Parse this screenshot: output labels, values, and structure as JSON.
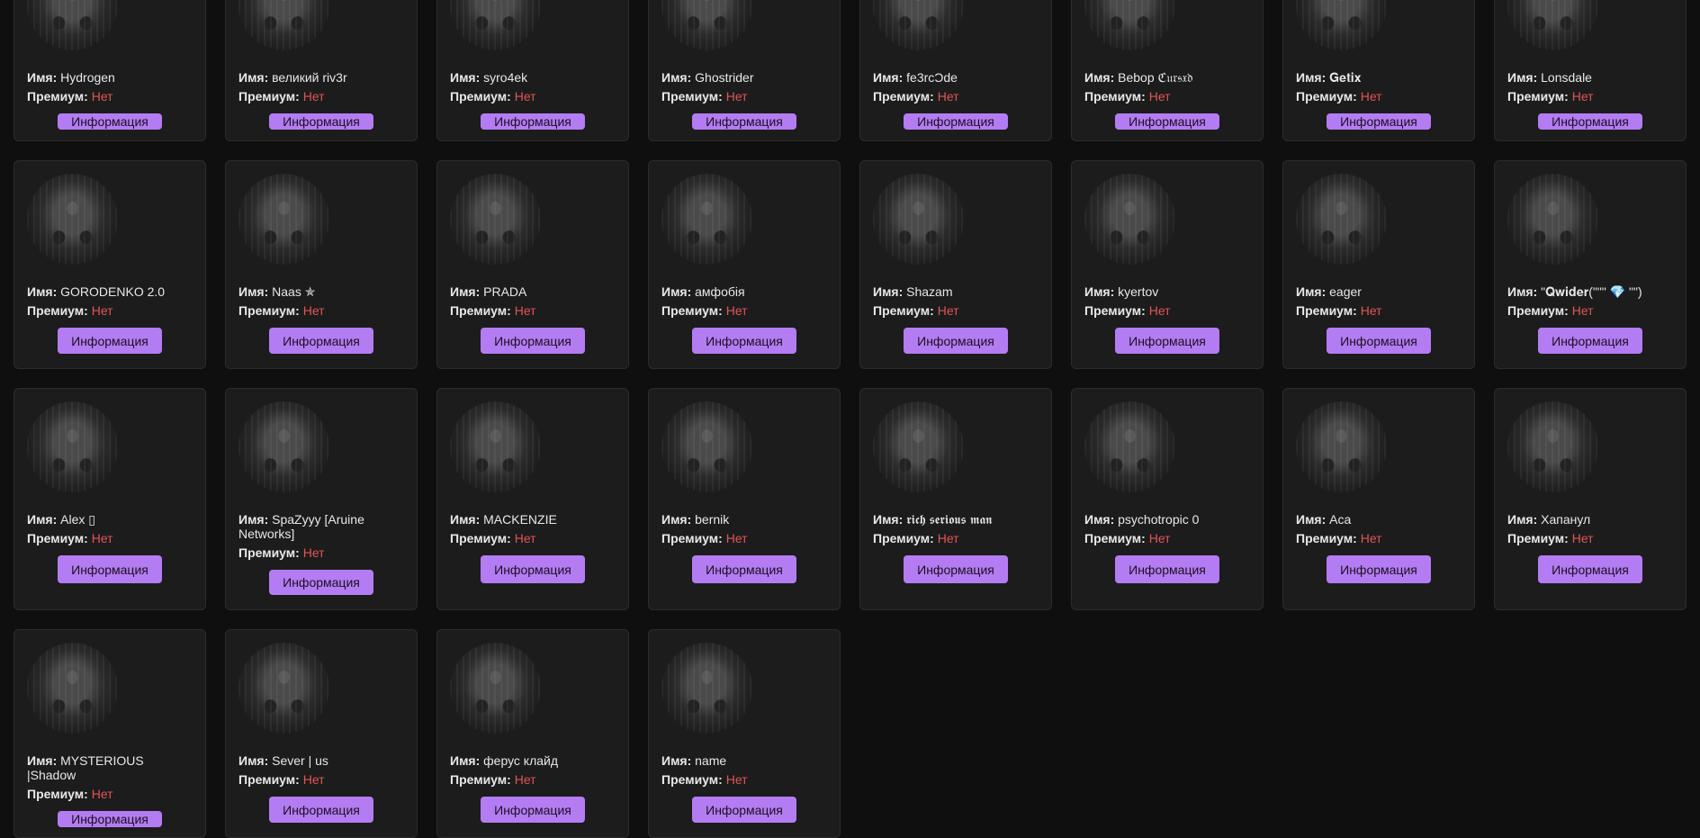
{
  "labels": {
    "name": "Имя:",
    "premium": "Премиум:",
    "button": "Информация"
  },
  "profiles": [
    {
      "name": "Hydrogen",
      "premium": "Нет"
    },
    {
      "name": "великий riv3r",
      "premium": "Нет"
    },
    {
      "name": "syro4ek",
      "premium": "Нет"
    },
    {
      "name": "Ghostrider",
      "premium": "Нет"
    },
    {
      "name": "fe3rcƆde",
      "premium": "Нет"
    },
    {
      "name": "Bebop ℭ𝔲𝔯𝔰𝔵𝔡",
      "premium": "Нет"
    },
    {
      "name": "𝐆𝐞𝐭𝐢𝐱",
      "premium": "Нет"
    },
    {
      "name": "Lonsdale",
      "premium": "Нет"
    },
    {
      "name": "GORODENKO 2.0",
      "premium": "Нет"
    },
    {
      "name": "Naas ✯",
      "premium": "Нет"
    },
    {
      "name": "PRADA",
      "premium": "Нет"
    },
    {
      "name": "амфобія",
      "premium": "Нет"
    },
    {
      "name": "Shazam",
      "premium": "Нет"
    },
    {
      "name": "kyertov",
      "premium": "Нет"
    },
    {
      "name": "eager",
      "premium": "Нет"
    },
    {
      "name": "\"𝐐𝐰𝐢𝐝𝐞𝐫(\"\"\" 💎 \"\")",
      "premium": "Нет"
    },
    {
      "name": "Alex ▯",
      "premium": "Нет"
    },
    {
      "name": "SpaZyyy [Aruine Networks]",
      "premium": "Нет"
    },
    {
      "name": "MACKENZIE",
      "premium": "Нет"
    },
    {
      "name": "bernik",
      "premium": "Нет"
    },
    {
      "name": "𝖗𝖎𝖈𝖍 𝖘𝖊𝖗𝖎𝖔𝖚𝖘 𝖒𝖆𝖓",
      "premium": "Нет"
    },
    {
      "name": "psychotropic 0",
      "premium": "Нет"
    },
    {
      "name": "Aca",
      "premium": "Нет"
    },
    {
      "name": "Хапанул",
      "premium": "Нет"
    },
    {
      "name": "MYSTERIOUS |Shadow",
      "premium": "Нет"
    },
    {
      "name": "Sever | us",
      "premium": "Нет"
    },
    {
      "name": "ферус клайд",
      "premium": "Нет"
    },
    {
      "name": "name",
      "premium": "Нет"
    }
  ]
}
